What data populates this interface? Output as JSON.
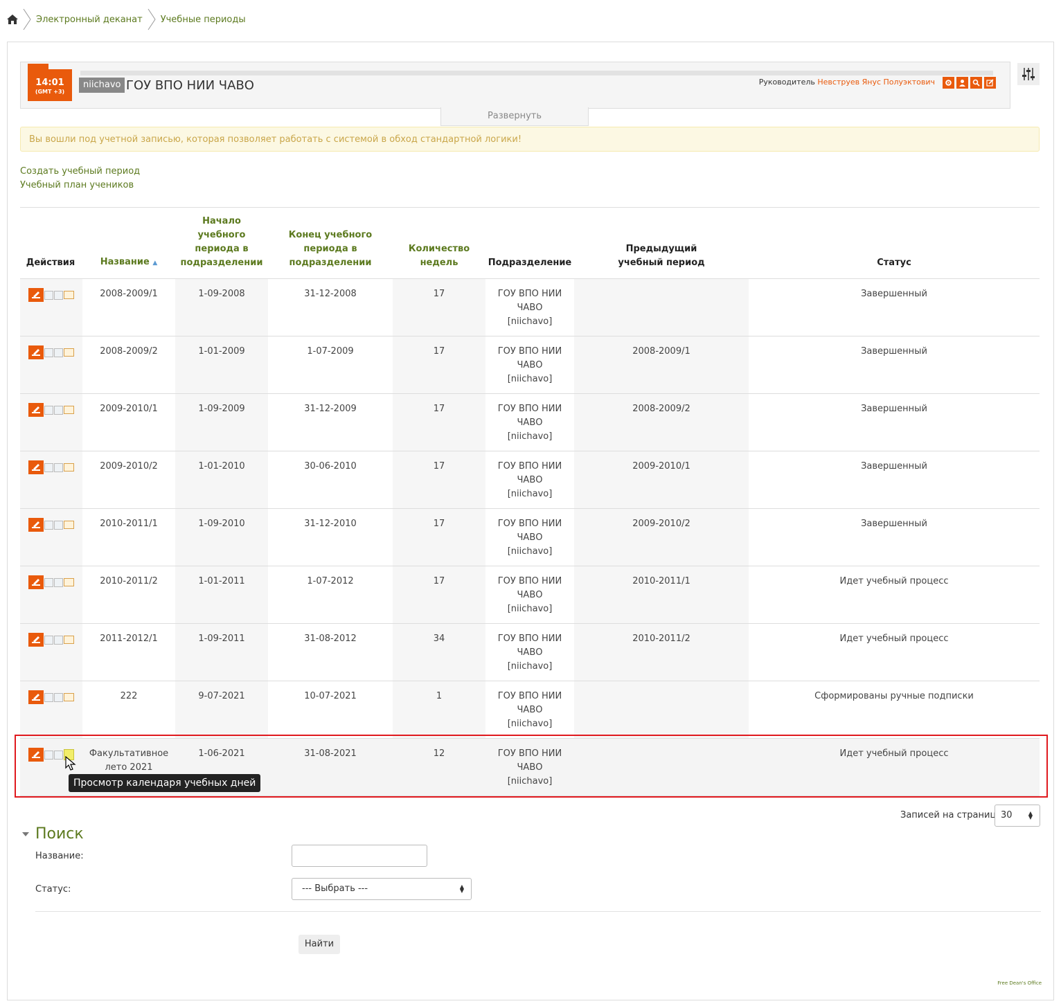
{
  "breadcrumb": {
    "items": [
      "Электронный деканат",
      "Учебные периоды"
    ]
  },
  "header": {
    "time": "14:01",
    "timezone": "(GMT +3)",
    "org_code": "niichavo",
    "org_title": "ГОУ ВПО НИИ ЧАВО",
    "manager_label": "Руководитель",
    "manager_name": "Невструев Янус Полуэктович",
    "expand_label": "Развернуть"
  },
  "alert": {
    "text": "Вы вошли под учетной записью, которая позволяет работать с системой в обход стандартной логики!"
  },
  "links": {
    "create_period": "Создать учебный период",
    "students_plan": "Учебный план учеников"
  },
  "table": {
    "headers": {
      "actions": "Действия",
      "name": "Название",
      "start_lines": [
        "Начало",
        "учебного",
        "периода в",
        "подразделении"
      ],
      "end_lines": [
        "Конец учебного",
        "периода в",
        "подразделении"
      ],
      "weeks_lines": [
        "Количество",
        "недель"
      ],
      "department": "Подразделение",
      "prev_lines": [
        "Предыдущий",
        "учебный период"
      ],
      "status": "Статус"
    },
    "rows": [
      {
        "name1": "2008-2009/1",
        "name2": "",
        "start": "1-09-2008",
        "end": "31-12-2008",
        "weeks": "17",
        "dep1": "ГОУ ВПО НИИ",
        "dep2": "ЧАВО",
        "dep3": "[niichavo]",
        "prev": "",
        "status": "Завершенный"
      },
      {
        "name1": "2008-2009/2",
        "name2": "",
        "start": "1-01-2009",
        "end": "1-07-2009",
        "weeks": "17",
        "dep1": "ГОУ ВПО НИИ",
        "dep2": "ЧАВО",
        "dep3": "[niichavo]",
        "prev": "2008-2009/1",
        "status": "Завершенный"
      },
      {
        "name1": "2009-2010/1",
        "name2": "",
        "start": "1-09-2009",
        "end": "31-12-2009",
        "weeks": "17",
        "dep1": "ГОУ ВПО НИИ",
        "dep2": "ЧАВО",
        "dep3": "[niichavo]",
        "prev": "2008-2009/2",
        "status": "Завершенный"
      },
      {
        "name1": "2009-2010/2",
        "name2": "",
        "start": "1-01-2010",
        "end": "30-06-2010",
        "weeks": "17",
        "dep1": "ГОУ ВПО НИИ",
        "dep2": "ЧАВО",
        "dep3": "[niichavo]",
        "prev": "2009-2010/1",
        "status": "Завершенный"
      },
      {
        "name1": "2010-2011/1",
        "name2": "",
        "start": "1-09-2010",
        "end": "31-12-2010",
        "weeks": "17",
        "dep1": "ГОУ ВПО НИИ",
        "dep2": "ЧАВО",
        "dep3": "[niichavo]",
        "prev": "2009-2010/2",
        "status": "Завершенный"
      },
      {
        "name1": "2010-2011/2",
        "name2": "",
        "start": "1-01-2011",
        "end": "1-07-2012",
        "weeks": "17",
        "dep1": "ГОУ ВПО НИИ",
        "dep2": "ЧАВО",
        "dep3": "[niichavo]",
        "prev": "2010-2011/1",
        "status": "Идет учебный процесс"
      },
      {
        "name1": "2011-2012/1",
        "name2": "",
        "start": "1-09-2011",
        "end": "31-08-2012",
        "weeks": "34",
        "dep1": "ГОУ ВПО НИИ",
        "dep2": "ЧАВО",
        "dep3": "[niichavo]",
        "prev": "2010-2011/2",
        "status": "Идет учебный процесс"
      },
      {
        "name1": "222",
        "name2": "",
        "start": "9-07-2021",
        "end": "10-07-2021",
        "weeks": "1",
        "dep1": "ГОУ ВПО НИИ",
        "dep2": "ЧАВО",
        "dep3": "[niichavo]",
        "prev": "",
        "status": "Сформированы ручные подписки"
      },
      {
        "name1": "Факультативное",
        "name2": "лето 2021",
        "start": "1-06-2021",
        "end": "31-08-2021",
        "weeks": "12",
        "dep1": "ГОУ ВПО НИИ",
        "dep2": "ЧАВО",
        "dep3": "[niichavo]",
        "prev": "",
        "status": "Идет учебный процесс"
      }
    ]
  },
  "tooltip": "Просмотр календаря учебных дней",
  "pagination": {
    "per_page_label": "Записей на странице:",
    "per_page_value": "30"
  },
  "search": {
    "title": "Поиск",
    "name_label": "Название:",
    "name_value": "",
    "status_label": "Статус:",
    "status_value": "--- Выбрать ---",
    "submit": "Найти"
  },
  "footer": "Free Dean's Office",
  "colors": {
    "accent": "#e95a0c",
    "link": "#5c7a1f",
    "highlight_border": "#e0191e"
  },
  "icons": {
    "home": "home-icon",
    "settings": "sliders-icon",
    "edit": "edit-icon",
    "view": "magnifier-icon",
    "subscriptions": "subscribe-icon",
    "calendar": "calendar-icon"
  }
}
